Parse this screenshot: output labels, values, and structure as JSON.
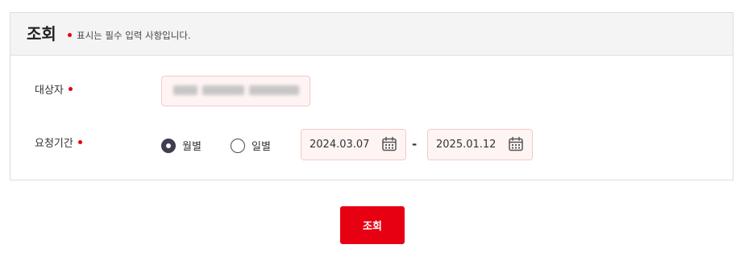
{
  "header": {
    "title": "조회",
    "required_note": "표시는 필수 입력 사항입니다."
  },
  "form": {
    "target": {
      "label": "대상자",
      "value_obscured": true
    },
    "period": {
      "label": "요청기간",
      "options": [
        {
          "label": "월별",
          "checked": true
        },
        {
          "label": "일별",
          "checked": false
        }
      ],
      "start_date": "2024.03.07",
      "end_date": "2025.01.12",
      "separator": "-"
    }
  },
  "actions": {
    "search_label": "조회"
  },
  "colors": {
    "accent": "#e60012",
    "field_bg": "#fff4f4",
    "field_border": "#f6c8c8",
    "header_bg": "#f4f4f4",
    "radio_checked": "#3e3e50"
  },
  "icons": {
    "required": "required-dot",
    "date_picker": "calendar-icon"
  }
}
